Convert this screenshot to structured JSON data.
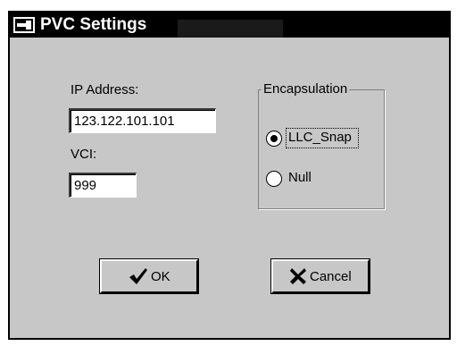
{
  "window": {
    "title": "PVC Settings",
    "icon": "network-plug-icon"
  },
  "form": {
    "ip_label": "IP Address:",
    "ip_value": "123.122.101.101",
    "vci_label": "VCI:",
    "vci_value": "999"
  },
  "encapsulation": {
    "legend": "Encapsulation",
    "options": [
      {
        "label": "LLC_Snap",
        "selected": true
      },
      {
        "label": "Null",
        "selected": false
      }
    ]
  },
  "buttons": {
    "ok_label": "OK",
    "ok_icon": "checkmark-icon",
    "cancel_label": "Cancel",
    "cancel_icon": "x-icon"
  }
}
